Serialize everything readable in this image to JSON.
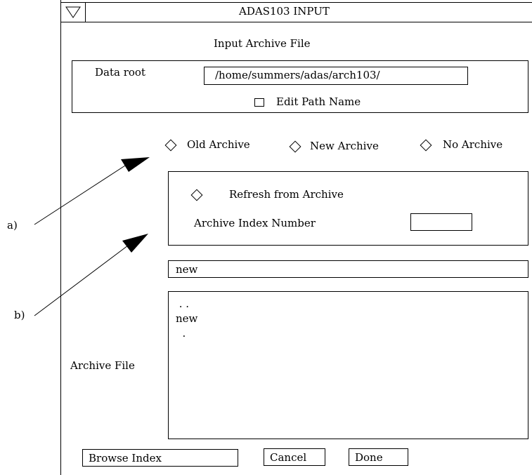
{
  "window": {
    "title": "ADAS103  INPUT",
    "menu_icon": "triangle-down-icon"
  },
  "section_title": "Input Archive File",
  "data_root": {
    "label": "Data root",
    "value": "/home/summers/adas/arch103/",
    "edit_label": "Edit Path Name"
  },
  "archive_options": [
    {
      "label": "Old Archive"
    },
    {
      "label": "New Archive"
    },
    {
      "label": "No Archive"
    }
  ],
  "refresh_panel": {
    "refresh_label": "Refresh from Archive",
    "index_label": "Archive Index Number",
    "index_value": ""
  },
  "archive": {
    "filename_value": "new",
    "list_items": [
      " . .",
      "new",
      "  ."
    ],
    "label": "Archive File"
  },
  "buttons": {
    "browse": "Browse Index",
    "cancel": "Cancel",
    "done": "Done"
  },
  "annotations": {
    "a": "a)",
    "b": "b)"
  }
}
